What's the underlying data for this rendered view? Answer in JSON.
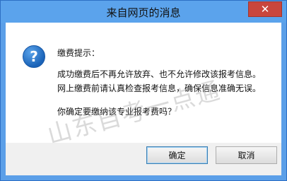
{
  "window": {
    "title": "来自网页的消息",
    "close_glyph": "✕"
  },
  "dialog": {
    "icon": "question-icon",
    "icon_glyph": "?",
    "heading": "缴费提示：",
    "line1": "成功缴费后不再允许放弃、也不允许修改该报考信息。",
    "line2": "网上缴费前请认真检查报考信息，确保信息准确无误。",
    "question": "你确定要缴纳该专业报考费吗？",
    "watermark": "山东自考一点通"
  },
  "buttons": {
    "ok": "确定",
    "cancel": "取消"
  },
  "colors": {
    "titlebar": "#5ba3ec",
    "close": "#c9463d"
  }
}
